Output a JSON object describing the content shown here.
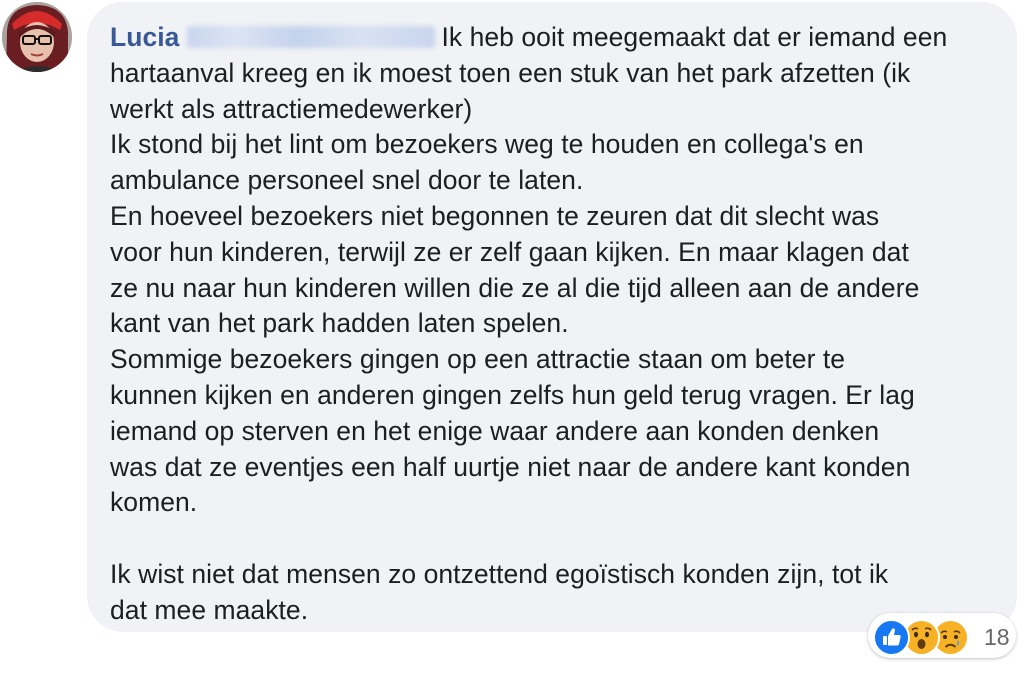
{
  "comment": {
    "author": "Lucia",
    "first_line": "Ik heb ooit meegemaakt dat er iemand een",
    "lines": [
      "hartaanval kreeg en ik moest toen een stuk van het park afzetten (ik",
      "werkt als attractiemedewerker)",
      "Ik stond bij het lint om bezoekers weg te houden en collega's en",
      "ambulance personeel snel door te laten.",
      "En hoeveel bezoekers niet begonnen te zeuren dat dit slecht was",
      "voor hun kinderen, terwijl ze er zelf gaan kijken. En maar klagen dat",
      "ze nu naar hun kinderen willen die ze al die tijd alleen aan de andere",
      "kant van het park hadden laten spelen.",
      "Sommige bezoekers gingen op een attractie staan om beter te",
      "kunnen kijken en anderen gingen zelfs hun geld terug vragen. Er lag",
      "iemand op sterven en het enige waar andere aan konden denken",
      "was dat ze eventjes een half uurtje niet naar de andere kant konden",
      "komen."
    ],
    "closing_lines": [
      "Ik wist niet dat mensen zo ontzettend egoïstisch konden zijn, tot ik",
      "dat mee maakte."
    ]
  },
  "reactions": {
    "icons": [
      "like-icon",
      "wow-icon",
      "sad-icon"
    ],
    "count": "18"
  },
  "colors": {
    "bubble_bg": "#f0f2f5",
    "author_link": "#385898",
    "text": "#1c1e21",
    "like_blue": "#1877f2",
    "emoji_yellow": "#f7b125"
  }
}
